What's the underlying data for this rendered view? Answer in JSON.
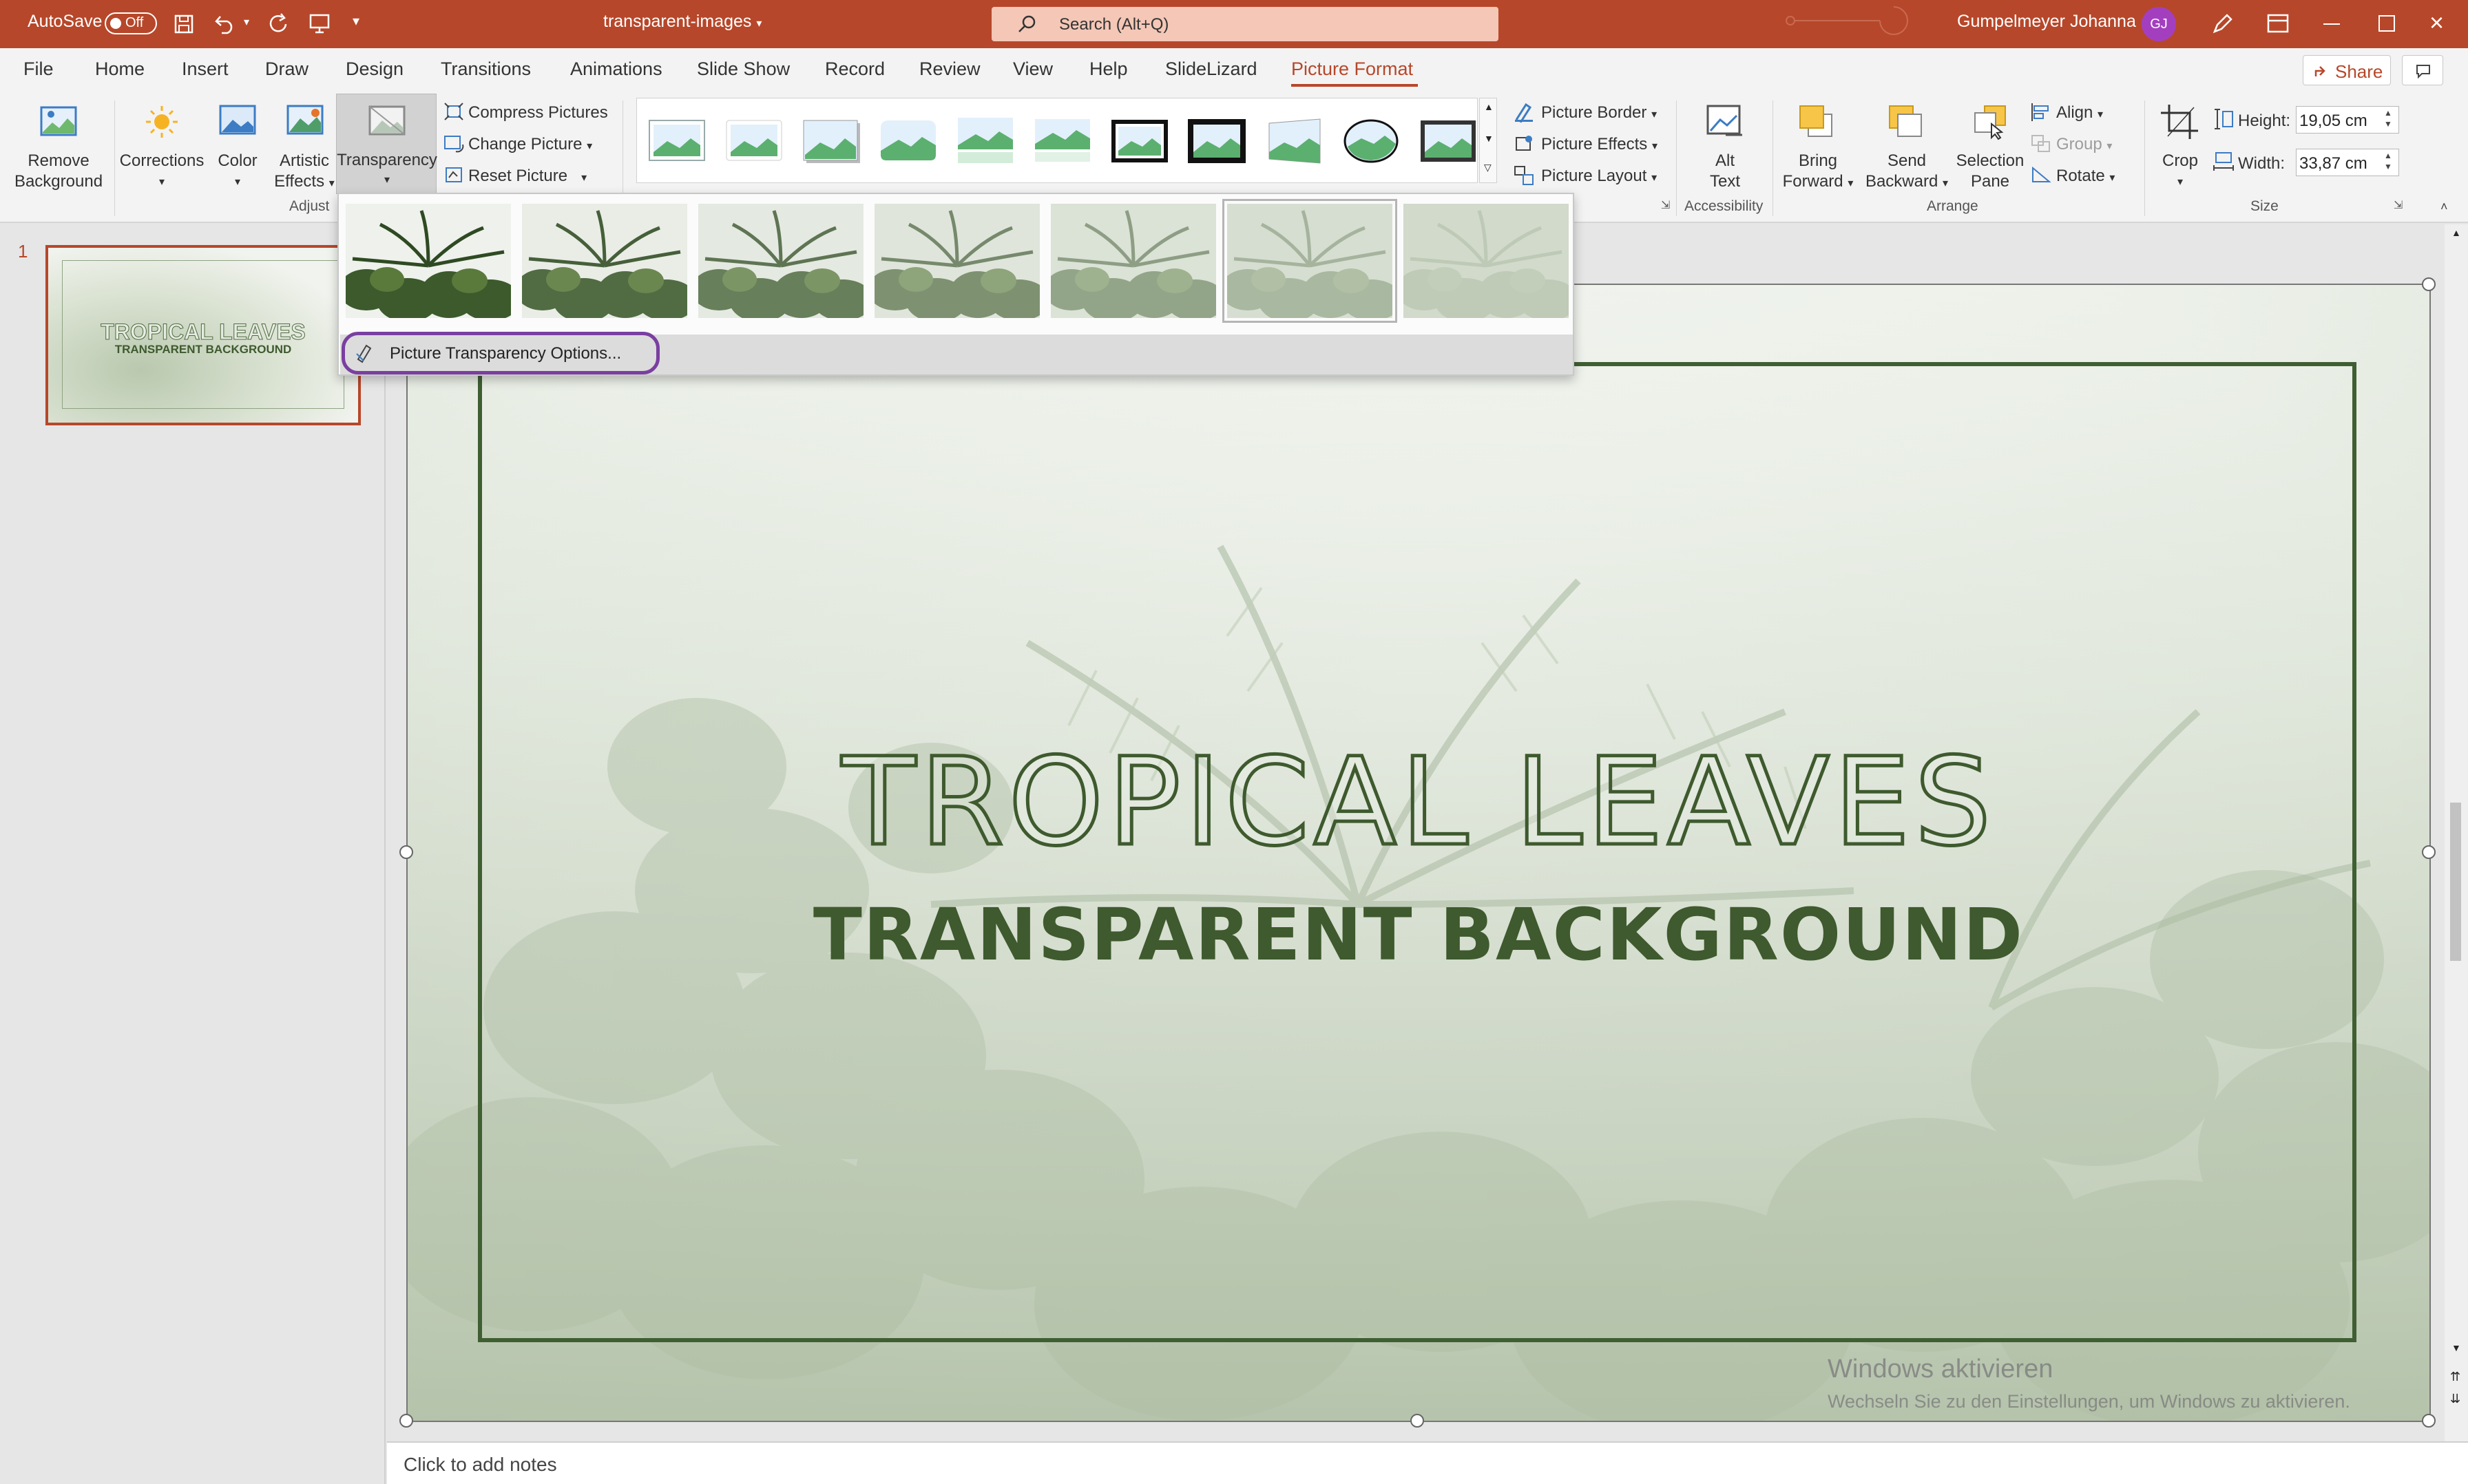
{
  "titlebar": {
    "autosave_label": "AutoSave",
    "autosave_state": "Off",
    "doc_title": "transparent-images",
    "search_placeholder": "Search (Alt+Q)",
    "user_name": "Gumpelmeyer Johanna",
    "user_initials": "GJ"
  },
  "tabs": [
    "File",
    "Home",
    "Insert",
    "Draw",
    "Design",
    "Transitions",
    "Animations",
    "Slide Show",
    "Record",
    "Review",
    "View",
    "Help",
    "SlideLizard",
    "Picture Format"
  ],
  "active_tab": "Picture Format",
  "share_label": "Share",
  "ribbon": {
    "remove_background": [
      "Remove",
      "Background"
    ],
    "corrections": "Corrections",
    "color": "Color",
    "artistic_effects": [
      "Artistic",
      "Effects"
    ],
    "transparency": "Transparency",
    "compress_pictures": "Compress Pictures",
    "change_picture": "Change Picture",
    "reset_picture": "Reset Picture",
    "adjust_group": "Adjust",
    "picture_border": "Picture Border",
    "picture_effects": "Picture Effects",
    "picture_layout": "Picture Layout",
    "alt_text": [
      "Alt",
      "Text"
    ],
    "accessibility_group": "Accessibility",
    "bring_forward": [
      "Bring",
      "Forward"
    ],
    "send_backward": [
      "Send",
      "Backward"
    ],
    "selection_pane": [
      "Selection",
      "Pane"
    ],
    "align": "Align",
    "group": "Group",
    "rotate": "Rotate",
    "arrange_group": "Arrange",
    "crop": "Crop",
    "height_label": "Height:",
    "height_value": "19,05 cm",
    "width_label": "Width:",
    "width_value": "33,87 cm",
    "size_group": "Size"
  },
  "transparency_menu": {
    "presets_opacity": [
      1.0,
      0.85,
      0.7,
      0.55,
      0.4,
      0.25,
      0.1
    ],
    "selected_index": 5,
    "options_label": "Picture Transparency Options..."
  },
  "slide_number": "1",
  "thumbnail": {
    "title": "TROPICAL LEAVES",
    "subtitle": "TRANSPARENT BACKGROUND"
  },
  "slide": {
    "title": "TROPICAL LEAVES",
    "subtitle": "TRANSPARENT BACKGROUND"
  },
  "watermark": {
    "line1": "Windows aktivieren",
    "line2": "Wechseln Sie zu den Einstellungen, um Windows zu aktivieren."
  },
  "notes_placeholder": "Click to add notes",
  "colors": {
    "titlebar": "#b7472a",
    "accent": "#b7472a",
    "frame": "#3f5f32",
    "title_text": "#3e5a2e",
    "highlight": "#7a3fa0"
  }
}
